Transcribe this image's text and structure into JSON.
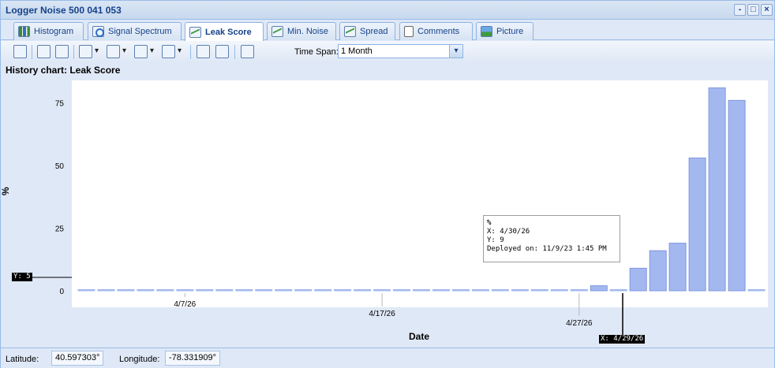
{
  "window": {
    "title": "Logger Noise 500 041 053",
    "buttons": [
      "-",
      "□",
      "×"
    ]
  },
  "tabs": [
    {
      "label": "Histogram",
      "icon": "histogram-icon",
      "active": false
    },
    {
      "label": "Signal Spectrum",
      "icon": "spectrum-icon",
      "active": false
    },
    {
      "label": "Leak Score",
      "icon": "line-chart-icon",
      "active": true
    },
    {
      "label": "Min. Noise",
      "icon": "line-chart-icon",
      "active": false
    },
    {
      "label": "Spread",
      "icon": "line-chart-icon",
      "active": false
    },
    {
      "label": "Comments",
      "icon": "document-icon",
      "active": false
    },
    {
      "label": "Picture",
      "icon": "picture-icon",
      "active": false
    }
  ],
  "toolbar": {
    "timespan_label": "Time Span:",
    "timespan_value": "1 Month"
  },
  "chart_title": "History chart: Leak Score",
  "chart_data": {
    "type": "bar",
    "xlabel": "Date",
    "ylabel": "%",
    "ylim": [
      0,
      84
    ],
    "yticks": [
      0,
      25,
      50,
      75
    ],
    "xtick_labels": [
      "4/7/26",
      "4/17/26",
      "4/27/26"
    ],
    "series": [
      {
        "color": "#a4b8f0",
        "x": [
          "4/2/26",
          "4/3/26",
          "4/4/26",
          "4/5/26",
          "4/6/26",
          "4/7/26",
          "4/8/26",
          "4/9/26",
          "4/10/26",
          "4/11/26",
          "4/12/26",
          "4/13/26",
          "4/14/26",
          "4/15/26",
          "4/16/26",
          "4/17/26",
          "4/18/26",
          "4/19/26",
          "4/20/26",
          "4/21/26",
          "4/22/26",
          "4/23/26",
          "4/24/26",
          "4/25/26",
          "4/26/26",
          "4/27/26",
          "4/28/26",
          "4/29/26",
          "4/30/26",
          "5/1/26",
          "5/2/26",
          "5/3/26",
          "5/4/26",
          "5/5/26",
          "5/6/26"
        ],
        "values": [
          0,
          0,
          0,
          0,
          0,
          0,
          0,
          0,
          0,
          0,
          0,
          0,
          0,
          0,
          0,
          0,
          0,
          0,
          0,
          0,
          0,
          0,
          0,
          0,
          0,
          0,
          2,
          0,
          9,
          16,
          19,
          53,
          81,
          76,
          0
        ]
      }
    ],
    "grid": false,
    "legend": "none"
  },
  "tooltip": {
    "title": "%",
    "x_line": "X: 4/30/26",
    "y_line": "Y: 9",
    "deployed_line": "Deployed on: 11/9/23 1:45 PM"
  },
  "crosshair": {
    "y_label": "Y: 5",
    "x_label": "X: 4/29/26"
  },
  "status": {
    "latitude_label": "Latitude:",
    "latitude_value": "40.597303°",
    "longitude_label": "Longitude:",
    "longitude_value": "-78.331909°"
  }
}
